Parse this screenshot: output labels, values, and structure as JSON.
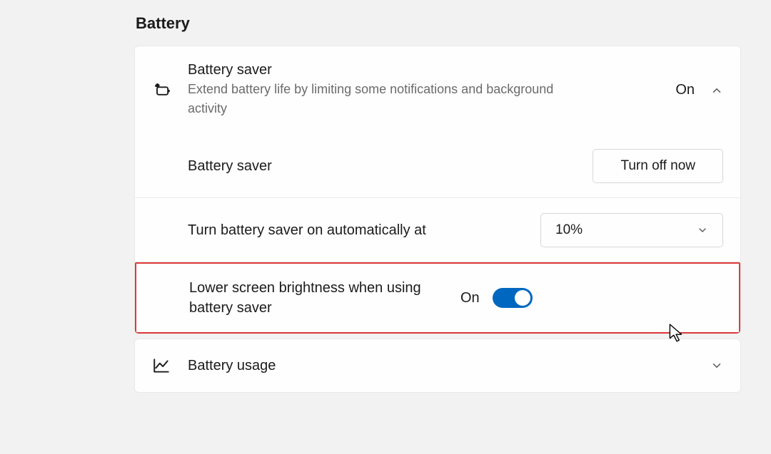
{
  "section": {
    "title": "Battery"
  },
  "battery_saver": {
    "title": "Battery saver",
    "subtitle": "Extend battery life by limiting some notifications and background activity",
    "state": "On",
    "sub": {
      "label": "Battery saver",
      "button": "Turn off now"
    },
    "auto": {
      "label": "Turn battery saver on automatically at",
      "value": "10%"
    },
    "brightness": {
      "label": "Lower screen brightness when using battery saver",
      "state": "On"
    }
  },
  "usage": {
    "label": "Battery usage"
  }
}
